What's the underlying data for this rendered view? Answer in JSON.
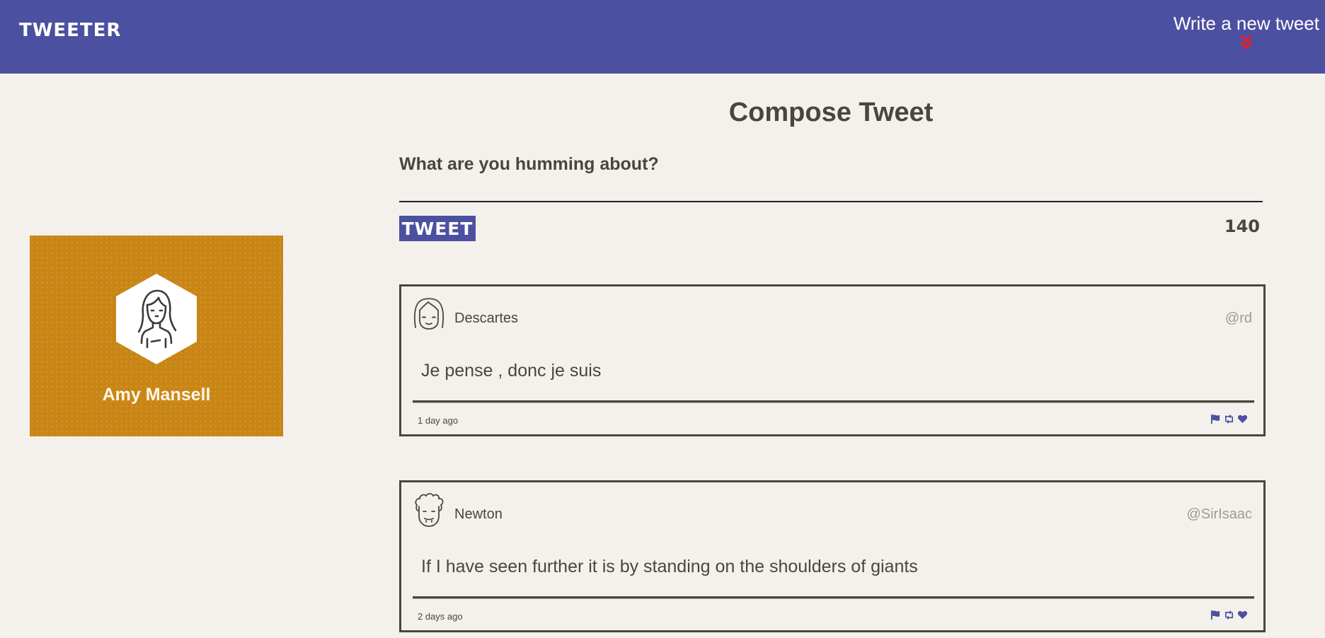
{
  "header": {
    "brand": "TWEETER",
    "compose_toggle_label": "Write a new tweet",
    "toggle_icon": "double-chevron-down-icon",
    "toggle_icon_color": "#e0202e"
  },
  "colors": {
    "nav_bg": "#4c50a0",
    "page_bg": "#f4f1ec",
    "profile_bg": "#c98616",
    "text": "#4a4540",
    "handle": "#a09a93",
    "action_icons": "#4c50a0"
  },
  "profile": {
    "name": "Amy Mansell",
    "avatar_icon": "woman-avatar-icon"
  },
  "compose": {
    "title": "Compose Tweet",
    "placeholder": "What are you humming about?",
    "button_label": "TWEET",
    "counter": "140"
  },
  "tweets": [
    {
      "name": "Descartes",
      "handle": "@rd",
      "content": "Je pense , donc je suis",
      "time": "1 day ago",
      "avatar_icon": "girl-avatar-icon",
      "actions": [
        "flag-icon",
        "retweet-icon",
        "heart-icon"
      ]
    },
    {
      "name": "Newton",
      "handle": "@SirIsaac",
      "content": "If I have seen further it is by standing on the shoulders of giants",
      "time": "2 days ago",
      "avatar_icon": "curly-hair-avatar-icon",
      "actions": [
        "flag-icon",
        "retweet-icon",
        "heart-icon"
      ]
    }
  ]
}
